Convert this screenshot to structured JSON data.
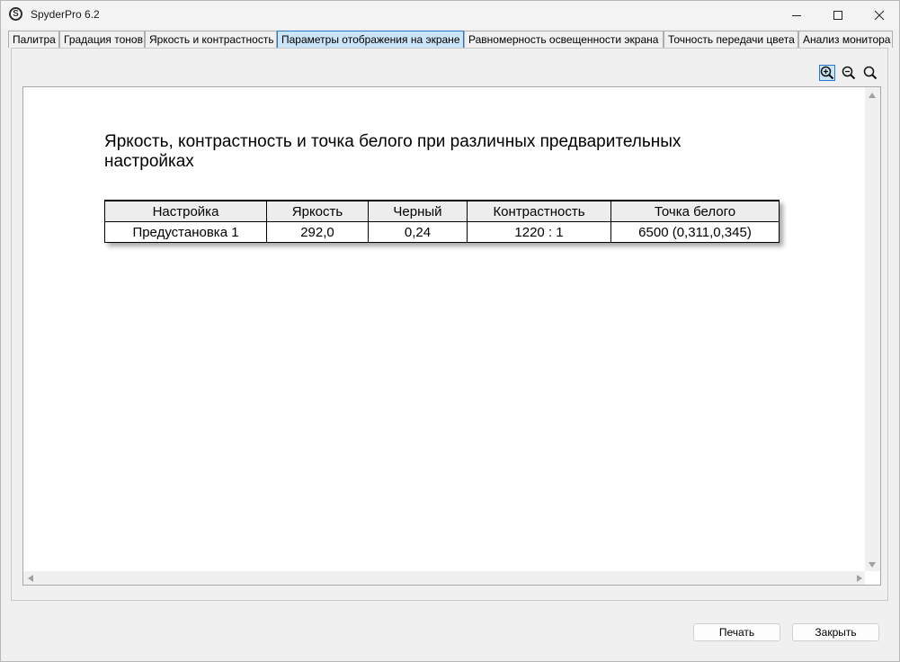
{
  "window": {
    "title": "SpyderPro 6.2",
    "app_icon_letter": "S"
  },
  "tabs": [
    {
      "label": "Палитра",
      "active": false
    },
    {
      "label": "Градация тонов",
      "active": false
    },
    {
      "label": "Яркость и контрастность",
      "active": false
    },
    {
      "label": "Параметры отображения на экране",
      "active": true
    },
    {
      "label": "Равномерность освещенности экрана",
      "active": false
    },
    {
      "label": "Точность передачи цвета",
      "active": false
    },
    {
      "label": "Анализ монитора",
      "active": false
    }
  ],
  "toolbar": {
    "zoom_in_icon": "zoom-in-icon",
    "zoom_out_icon": "zoom-out-icon",
    "zoom_reset_icon": "zoom-fit-icon"
  },
  "report": {
    "title": "Яркость, контрастность и точка белого при различных предварительных настройках",
    "columns": [
      "Настройка",
      "Яркость",
      "Черный",
      "Контрастность",
      "Точка белого"
    ],
    "rows": [
      [
        "Предустановка 1",
        "292,0",
        "0,24",
        "1220 : 1",
        "6500 (0,311,0,345)"
      ]
    ]
  },
  "buttons": {
    "print_label": "Печать",
    "close_label": "Закрыть"
  },
  "colors": {
    "active_tab_bg": "#cce4f7",
    "active_tab_border": "#2979c8",
    "header_bg": "#ededed"
  }
}
